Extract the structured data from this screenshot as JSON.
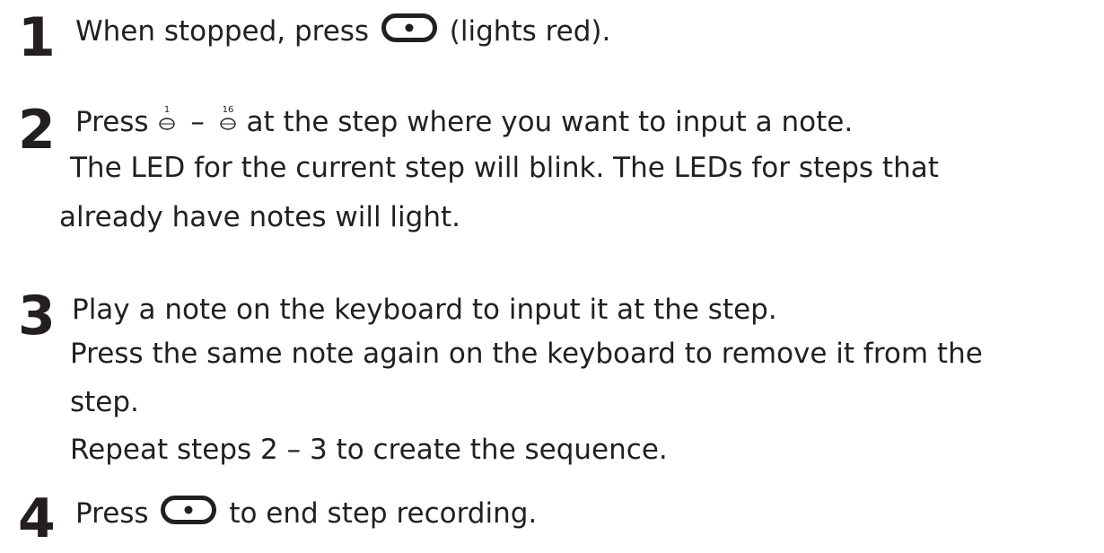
{
  "steps": [
    {
      "number": "1",
      "text_before": "When stopped, press",
      "icon": "record-button-icon",
      "text_after": "(lights red)."
    },
    {
      "number": "2",
      "text_before": "Press",
      "icon_first": "step-1-button-icon",
      "icon_first_label": "1",
      "range_sep": "–",
      "icon_last": "step-16-button-icon",
      "icon_last_label": "16",
      "text_after": "at the step where you want to input a note.",
      "line2": "The LED for the current step will blink. The LEDs for steps that",
      "line3": "already have notes will light."
    },
    {
      "number": "3",
      "line1": "Play a note on the keyboard to input it at the step.",
      "line2": "Press the same note again on the keyboard to remove it from the",
      "line3": "step.",
      "line4": "Repeat steps 2 – 3 to create the sequence."
    },
    {
      "number": "4",
      "text_before": "Press",
      "icon": "record-button-icon",
      "text_after": "to end step recording."
    }
  ]
}
